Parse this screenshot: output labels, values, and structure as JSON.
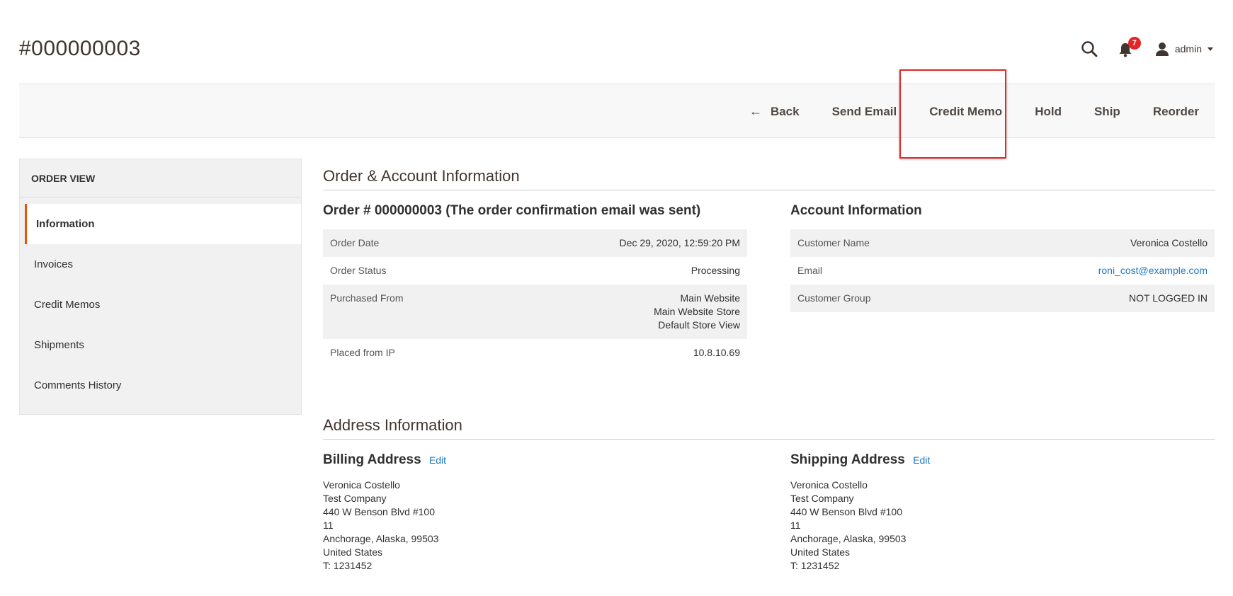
{
  "page_title": "#000000003",
  "header": {
    "notifications_count": "7",
    "user_name": "admin"
  },
  "actions": {
    "back": "Back",
    "send_email": "Send Email",
    "credit_memo": "Credit Memo",
    "hold": "Hold",
    "ship": "Ship",
    "reorder": "Reorder"
  },
  "sidebar": {
    "title": "ORDER VIEW",
    "items": [
      {
        "label": "Information"
      },
      {
        "label": "Invoices"
      },
      {
        "label": "Credit Memos"
      },
      {
        "label": "Shipments"
      },
      {
        "label": "Comments History"
      }
    ]
  },
  "order_account": {
    "section_title": "Order & Account Information",
    "order_title": "Order # 000000003 (The order confirmation email was sent)",
    "order_rows": [
      {
        "label": "Order Date",
        "value": "Dec 29, 2020, 12:59:20 PM"
      },
      {
        "label": "Order Status",
        "value": "Processing"
      },
      {
        "label": "Purchased From",
        "value1": "Main Website",
        "value2": "Main Website Store",
        "value3": "Default Store View"
      },
      {
        "label": "Placed from IP",
        "value": "10.8.10.69"
      }
    ],
    "account_title": "Account Information",
    "account_rows": [
      {
        "label": "Customer Name",
        "value": "Veronica Costello"
      },
      {
        "label": "Email",
        "value": "roni_cost@example.com"
      },
      {
        "label": "Customer Group",
        "value": "NOT LOGGED IN"
      }
    ]
  },
  "address": {
    "section_title": "Address Information",
    "edit_label": "Edit",
    "billing": {
      "title": "Billing Address",
      "lines": [
        "Veronica Costello",
        "Test Company",
        "440 W Benson Blvd #100",
        "11",
        "Anchorage, Alaska, 99503",
        "United States",
        "T: 1231452"
      ]
    },
    "shipping": {
      "title": "Shipping Address",
      "lines": [
        "Veronica Costello",
        "Test Company",
        "440 W Benson Blvd #100",
        "11",
        "Anchorage, Alaska, 99503",
        "United States",
        "T: 1231452"
      ]
    }
  }
}
